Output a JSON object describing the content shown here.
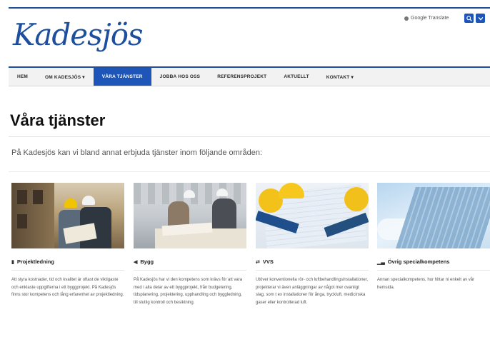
{
  "site": {
    "logo_text": "Kadesjös",
    "translate_label": "Google Translate"
  },
  "nav": {
    "items": [
      {
        "label": "HEM"
      },
      {
        "label": "OM KADESJÖS ▾"
      },
      {
        "label": "VÅRA TJÄNSTER",
        "active": true
      },
      {
        "label": "JOBBA HOS OSS"
      },
      {
        "label": "REFERENSPROJEKT"
      },
      {
        "label": "AKTUELLT"
      },
      {
        "label": "KONTAKT ▾"
      }
    ]
  },
  "page": {
    "title": "Våra tjänster",
    "intro": "På Kadesjös kan vi bland annat erbjuda tjänster inom följande områden:"
  },
  "cards": [
    {
      "title": "Projektledning",
      "icon": "document-icon",
      "text": "Att styra kostnader, tid och kvalitet är oftast de viktigaste och enklaste uppgifterna i ett byggprojekt. På Kadesjös finns stor kompetens och lång erfarenhet av projektledning."
    },
    {
      "title": "Bygg",
      "icon": "megaphone-icon",
      "text": "På Kadesjös har vi den kompetens som krävs för att vara med i alla delar av ett byggprojekt, från budgetering, tidsplanering, projektering, upphandling och byggledning, till slutlig kontroll och besiktning."
    },
    {
      "title": "VVS",
      "icon": "pipe-icon",
      "text": "Utöver konventionella rör- och luftbehandlingsinstallationer, projekterar vi även anläggningar av något mer ovanligt slag, som t ex installationer för ånga, tryckluft, medicinska gaser eller kontrollerad luft."
    },
    {
      "title": "Övrig specialkompetens",
      "icon": "chart-icon",
      "text": "Annan specialkompetens, hur hittar ni enkelt av vår hemsida."
    }
  ],
  "colors": {
    "brand_blue": "#1d56b8",
    "nav_bg": "#f2f2f2"
  }
}
